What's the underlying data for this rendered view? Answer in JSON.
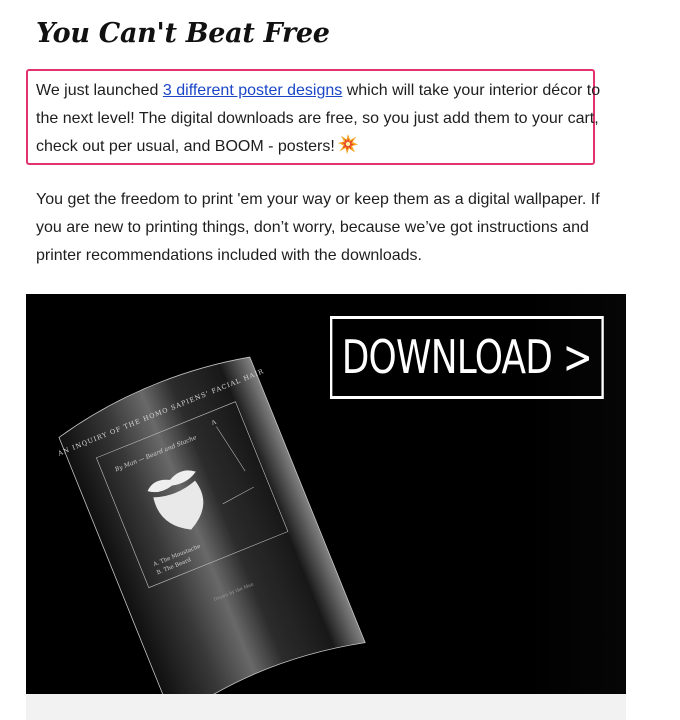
{
  "section": {
    "heading": "You Can't Beat Free"
  },
  "intro": {
    "text_before_link": "We just launched ",
    "link_text": "3 different poster designs",
    "text_after_link": " which will take your interior décor to the next level! The digital downloads are free, so you just add them to your cart, check out per usual, and BOOM - posters!",
    "emoji": "collision-emoji"
  },
  "body": {
    "text": "You get the freedom to print 'em your way or keep them as a digital wallpaper. If you are new to printing things, don’t worry, because we’ve got instructions and printer recommendations included with the downloads."
  },
  "hero": {
    "button_label": "DOWNLOAD >",
    "poster_title": "AN INQUIRY OF THE HOMO SAPIENS' FACIAL HAIR",
    "poster_byline": "By Man — Beard and Stache",
    "poster_legend_a": "A. The Moustache",
    "poster_legend_b": "B. The Beard",
    "poster_marker": "A",
    "poster_footer": "Drawn by the Man",
    "colors": {
      "background": "#000000",
      "poster": "#2a2a2a",
      "ink": "#e8e8e8"
    }
  },
  "colors": {
    "highlight_border": "#e2336f",
    "link": "#1a46c7"
  }
}
